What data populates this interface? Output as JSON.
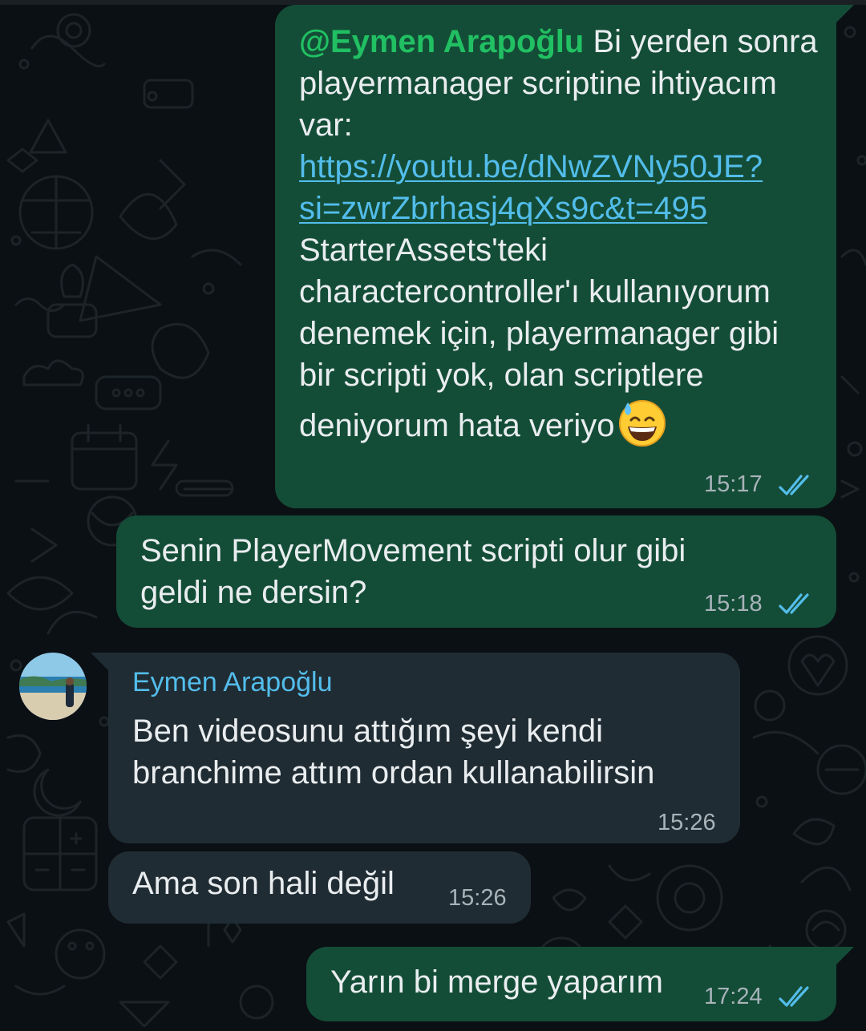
{
  "colors": {
    "background": "#0b1014",
    "outgoing_bubble": "#144d37",
    "incoming_bubble": "#202c33",
    "mention": "#21c063",
    "link": "#53bdeb",
    "read_ticks": "#53bdeb",
    "timestamp": "#a8b3ba"
  },
  "messages": [
    {
      "direction": "outgoing",
      "mention": "@Eymen Arapoğlu",
      "text_before_link": " Bi yerden sonra playermanager scriptine ihtiyacım var: ",
      "link": "https://youtu.be/dNwZVNy50JE?si=zwrZbrhasj4qXs9c&t=495",
      "text_after_link": "StarterAssets'teki charactercontroller'ı kullanıyorum denemek için, playermanager gibi bir scripti yok, olan scriptlere deniyorum hata veriyo",
      "emoji": "grinning-face-with-sweat",
      "time": "15:17",
      "status": "read-double-check-icon"
    },
    {
      "direction": "outgoing",
      "text": "Senin PlayerMovement scripti olur gibi geldi ne dersin?",
      "time": "15:18",
      "status": "read-double-check-icon"
    },
    {
      "direction": "incoming",
      "sender": "Eymen Arapoğlu",
      "avatar": "avatar-photo-beach",
      "text": "Ben videosunu attığım şeyi kendi branchime attım ordan kullanabilirsin",
      "time": "15:26"
    },
    {
      "direction": "incoming",
      "text": "Ama son hali değil",
      "time": "15:26"
    },
    {
      "direction": "outgoing",
      "text": "Yarın bi merge yaparım",
      "time": "17:24",
      "status": "read-double-check-icon"
    }
  ]
}
